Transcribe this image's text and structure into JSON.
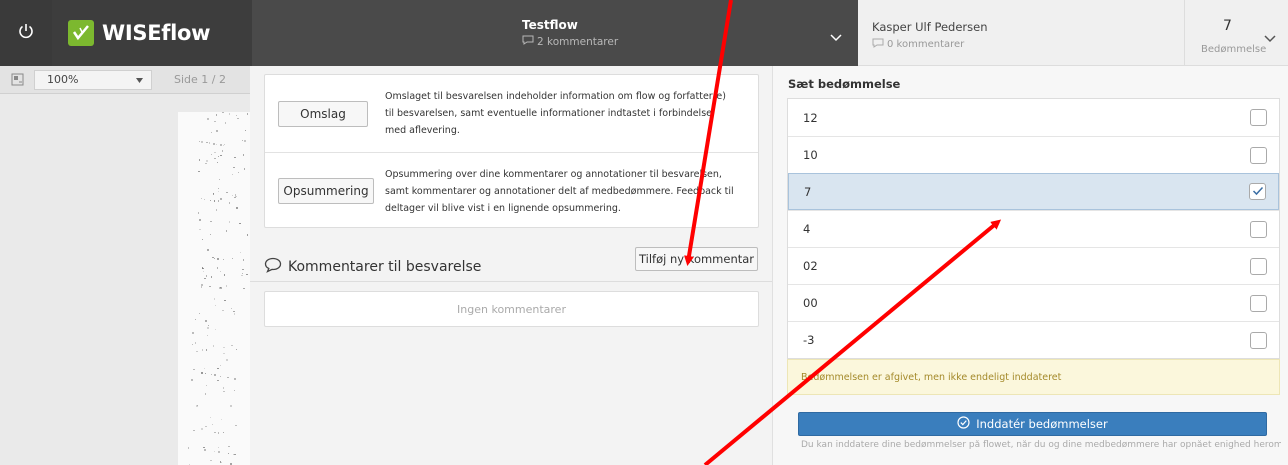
{
  "header": {
    "brand": "WISEflow",
    "flow_title": "Testflow",
    "flow_comments": "2 kommentarer",
    "student_name": "Kasper Ulf Pedersen",
    "student_comments": "0 kommentarer",
    "grade_value": "7",
    "grade_label": "Bedømmelse"
  },
  "viewer": {
    "zoom": "100%",
    "page": "Side 1 / 2"
  },
  "middle": {
    "cover_button": "Omslag",
    "cover_text": "Omslaget til besvarelsen indeholder information om flow og forfatter(e) til besvarelsen, samt eventuelle informationer indtastet i forbindelse med aflevering.",
    "summary_button": "Opsummering",
    "summary_text": "Opsummering over dine kommentarer og annotationer til besvarelsen, samt kommentarer og annotationer delt af medbedømmere. Feedback til deltager vil blive vist i en lignende opsummering.",
    "comments_heading": "Kommentarer til besvarelse",
    "add_comment_button": "Tilføj ny kommentar",
    "no_comments": "Ingen kommentarer"
  },
  "grading": {
    "title": "Sæt bedømmelse",
    "options": [
      {
        "label": "12",
        "checked": false
      },
      {
        "label": "10",
        "checked": false
      },
      {
        "label": "7",
        "checked": true
      },
      {
        "label": "4",
        "checked": false
      },
      {
        "label": "02",
        "checked": false
      },
      {
        "label": "00",
        "checked": false
      },
      {
        "label": "-3",
        "checked": false
      }
    ],
    "warning": "Bedømmelsen er afgivet, men ikke endeligt inddateret",
    "submit_button": "Inddatér bedømmelser",
    "submit_help": "Du kan inddatere dine bedømmelser på flowet, når du og dine medbedømmere har opnået enighed herom."
  },
  "colors": {
    "accent_blue": "#3a7ebd",
    "brand_green": "#7cb82f",
    "annotation_red": "#ff0000"
  }
}
